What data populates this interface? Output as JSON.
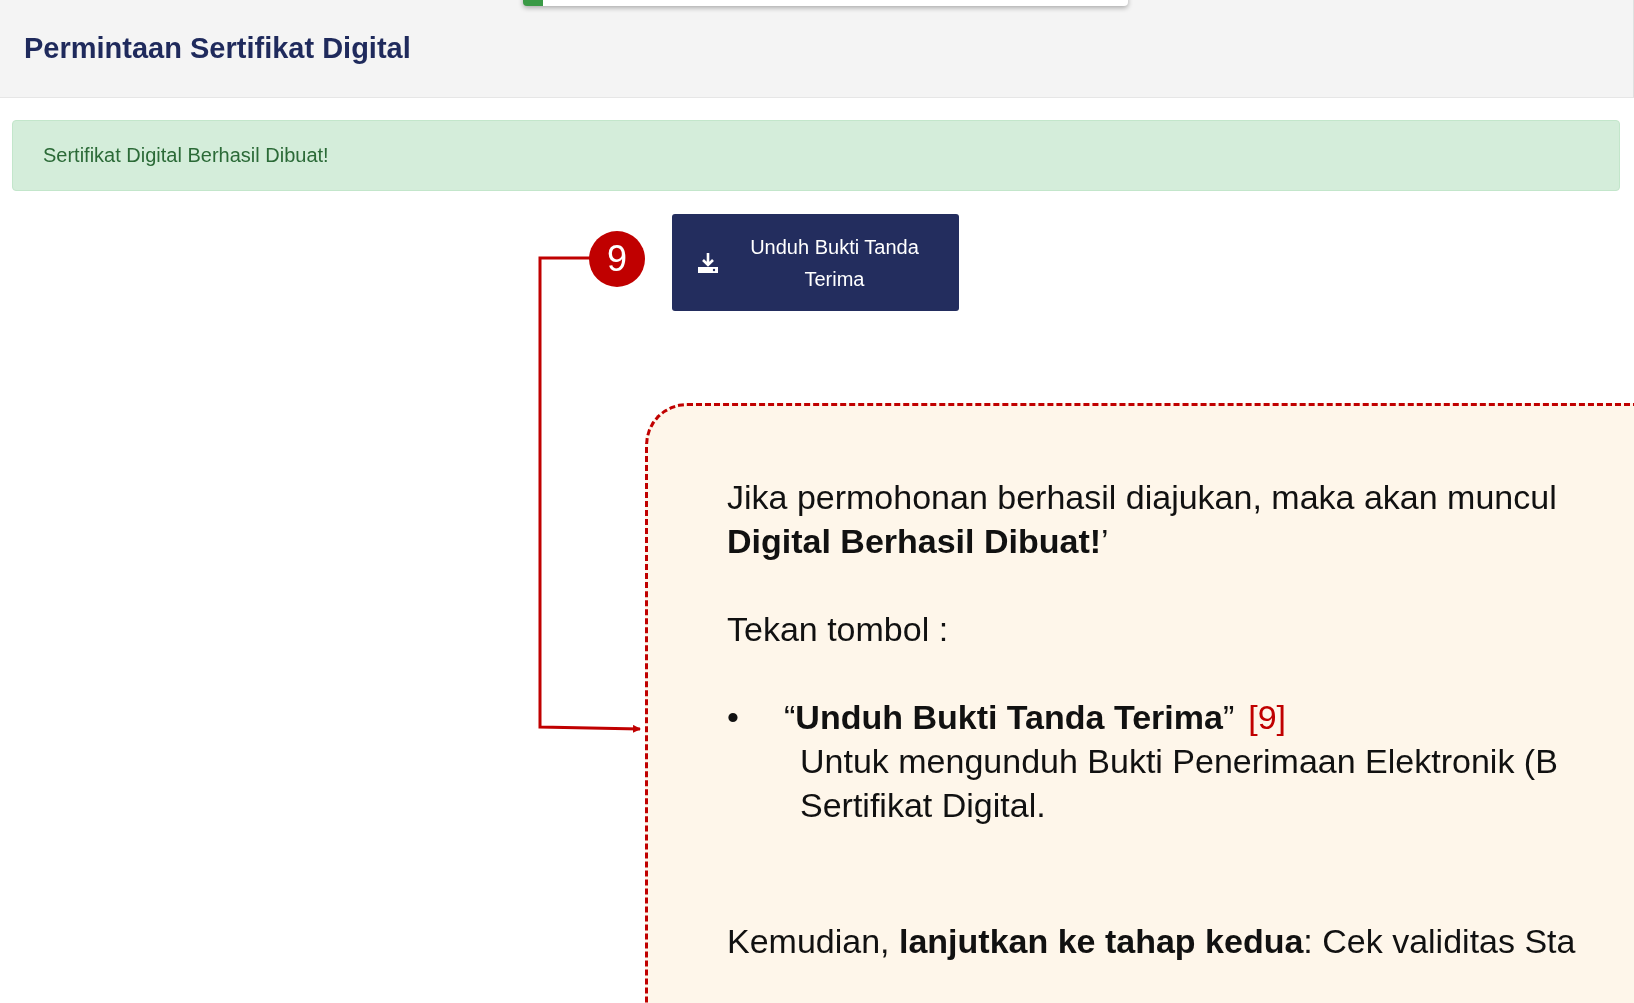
{
  "page_header": {
    "title": "Permintaan Sertifikat Digital"
  },
  "alert": {
    "message": "Sertifikat Digital Berhasil Dibuat!"
  },
  "download_button": {
    "label": "Unduh Bukti Tanda Terima"
  },
  "step_badge": "9",
  "callout": {
    "intro_lines": [
      "Jika permohonan berhasil diajukan, maka akan muncul",
      "**Digital Berhasil Dibuat!**’"
    ],
    "prompt": "Tekan tombol :",
    "bullets": [
      {
        "marker": "•",
        "title": "“**Unduh Bukti Tanda Terima**”",
        "ref": "[9]",
        "description_lines": [
          "Untuk mengunduh Bukti Penerimaan Elektronik (B",
          "Sertifikat Digital."
        ]
      }
    ],
    "closing": "Kemudian, **lanjutkan ke tahap kedua**: Cek validitas Sta"
  }
}
